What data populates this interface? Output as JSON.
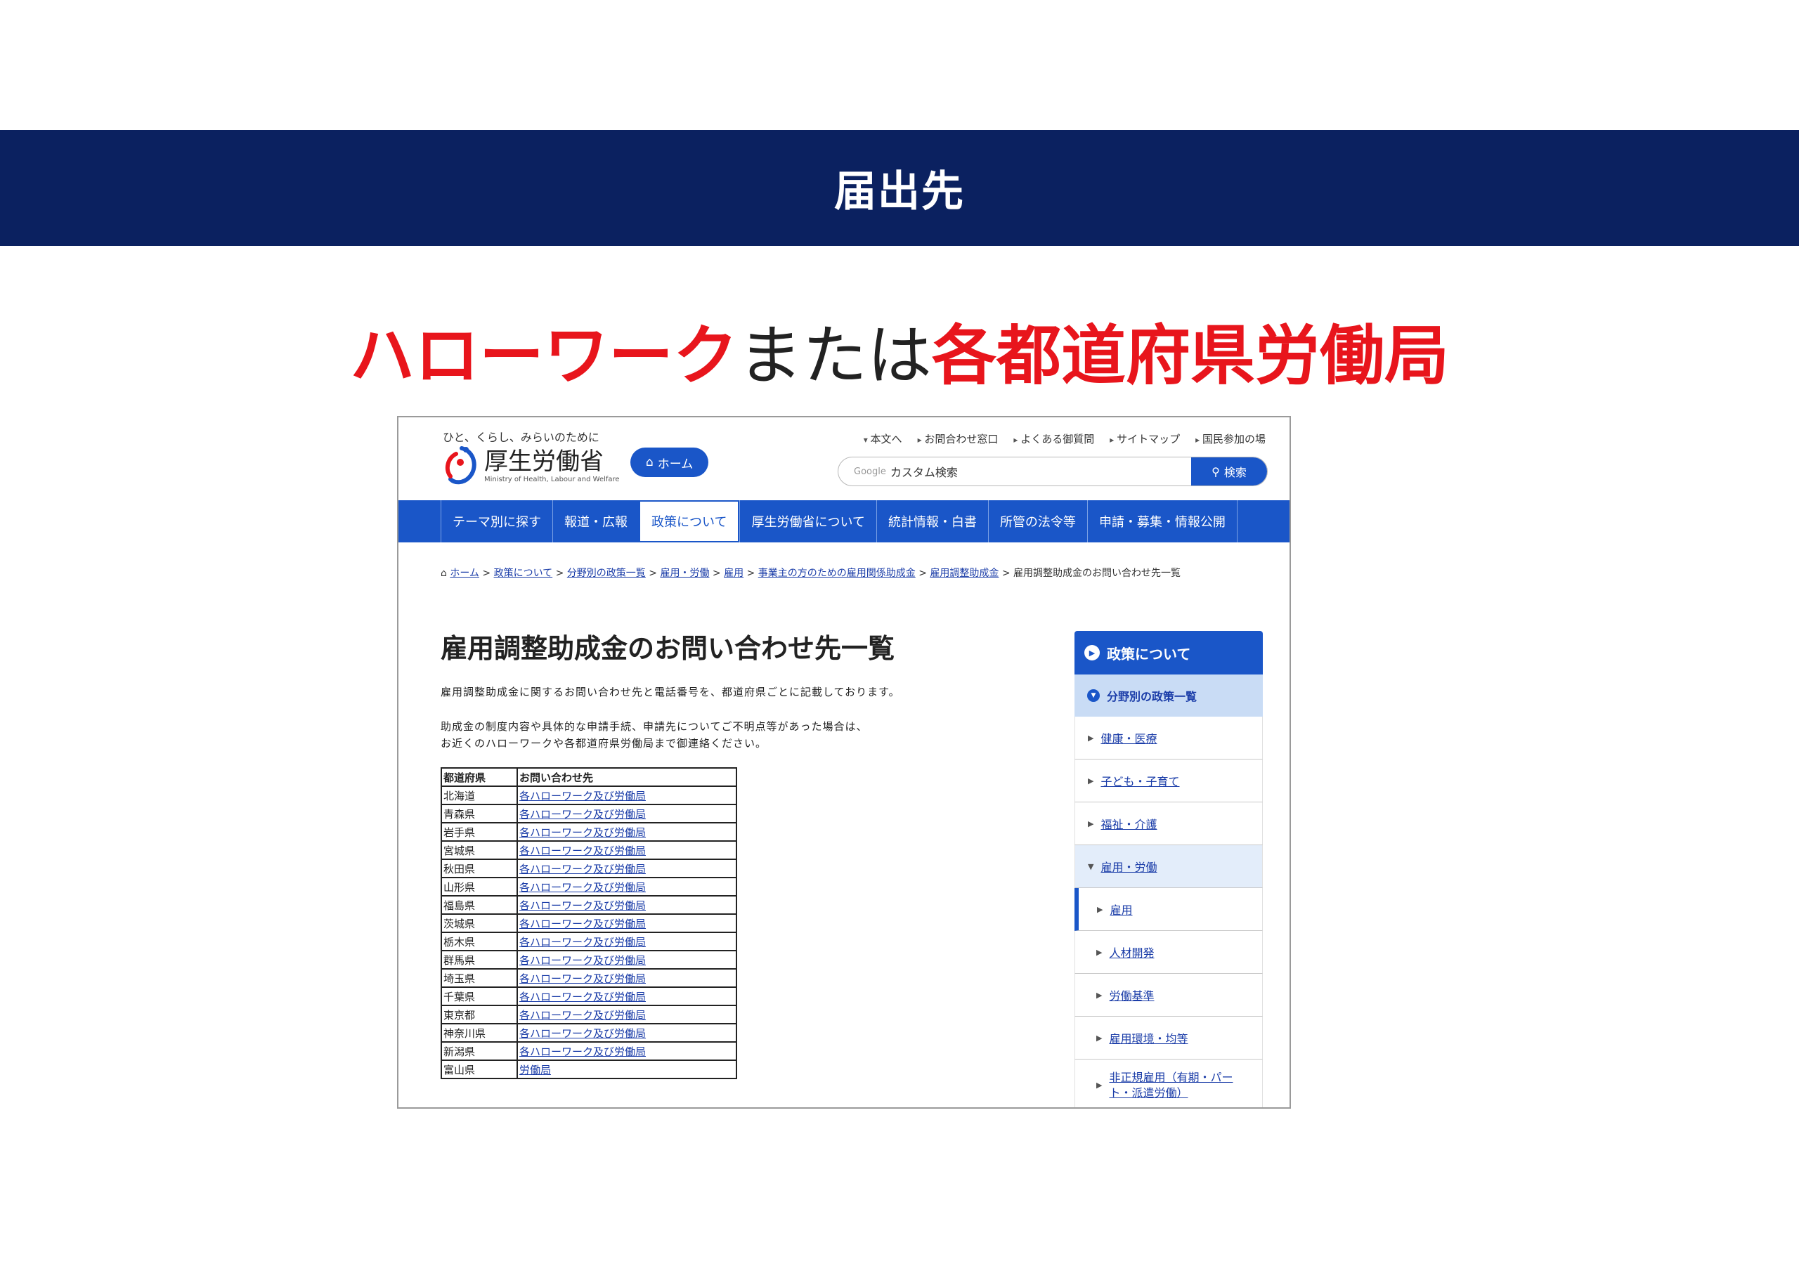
{
  "slide": {
    "title": "届出先",
    "headline": {
      "part1": "ハローワーク",
      "part2": "または",
      "part3": "各都道府県労働局"
    },
    "colors": {
      "banner": "#0b2160",
      "accent_red": "#e8151c",
      "site_blue": "#1a56c8"
    }
  },
  "site": {
    "tagline": "ひと、くらし、みらいのために",
    "logo_name": "厚生労働省",
    "logo_en": "Ministry of Health, Labour and Welfare",
    "home_button": "ホーム",
    "top_links": [
      "本文へ",
      "お問合わせ窓口",
      "よくある御質問",
      "サイトマップ",
      "国民参加の場"
    ],
    "search": {
      "brand": "Google",
      "text": "カスタム検索",
      "button": "検索"
    },
    "gnav": [
      "テーマ別に探す",
      "報道・広報",
      "政策について",
      "厚生労働省について",
      "統計情報・白書",
      "所管の法令等",
      "申請・募集・情報公開"
    ],
    "gnav_active": "政策について",
    "breadcrumb": {
      "home": "ホーム",
      "items": [
        "政策について",
        "分野別の政策一覧",
        "雇用・労働",
        "雇用",
        "事業主の方のための雇用関係助成金",
        "雇用調整助成金"
      ],
      "current": "雇用調整助成金のお問い合わせ先一覧",
      "separator": ">"
    },
    "page_title": "雇用調整助成金のお問い合わせ先一覧",
    "lead1": "雇用調整助成金に関するお問い合わせ先と電話番号を、都道府県ごとに記載しております。",
    "lead2_line1": "助成金の制度内容や具体的な申請手続、申請先についてご不明点等があった場合は、",
    "lead2_line2": "お近くのハローワークや各都道府県労働局まで御連絡ください。",
    "table": {
      "headers": [
        "都道府県",
        "お問い合わせ先"
      ],
      "rows": [
        [
          "北海道",
          "各ハローワーク及び労働局"
        ],
        [
          "青森県",
          "各ハローワーク及び労働局"
        ],
        [
          "岩手県",
          "各ハローワーク及び労働局"
        ],
        [
          "宮城県",
          "各ハローワーク及び労働局"
        ],
        [
          "秋田県",
          "各ハローワーク及び労働局"
        ],
        [
          "山形県",
          "各ハローワーク及び労働局"
        ],
        [
          "福島県",
          "各ハローワーク及び労働局"
        ],
        [
          "茨城県",
          "各ハローワーク及び労働局"
        ],
        [
          "栃木県",
          "各ハローワーク及び労働局"
        ],
        [
          "群馬県",
          "各ハローワーク及び労働局"
        ],
        [
          "埼玉県",
          "各ハローワーク及び労働局"
        ],
        [
          "千葉県",
          "各ハローワーク及び労働局"
        ],
        [
          "東京都",
          "各ハローワーク及び労働局"
        ],
        [
          "神奈川県",
          "各ハローワーク及び労働局"
        ],
        [
          "新潟県",
          "各ハローワーク及び労働局"
        ],
        [
          "富山県",
          "労働局"
        ]
      ]
    },
    "sidebar": {
      "heading": "政策について",
      "sub": "分野別の政策一覧",
      "items": [
        "健康・医療",
        "子ども・子育て",
        "福祉・介護",
        "雇用・労働"
      ],
      "children": [
        "雇用",
        "人材開発",
        "労働基準",
        "雇用環境・均等",
        "非正規雇用（有期・パート・派遣労働）"
      ]
    }
  }
}
